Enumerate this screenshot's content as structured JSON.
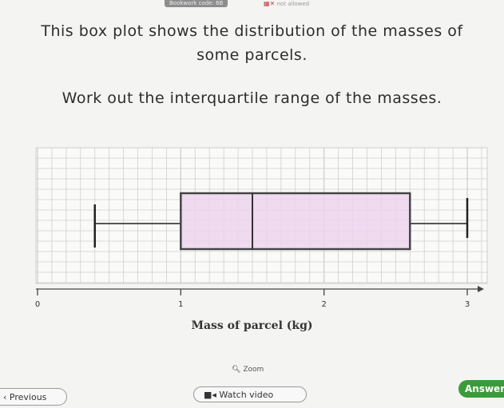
{
  "header": {
    "bookwork_code": "Bookwork code: 6B",
    "calculator_status": "not allowed",
    "calculator_icon": "calculator-crossed-icon"
  },
  "question": {
    "line1": "This box plot shows the distribution of the masses of",
    "line2": "some parcels.",
    "instruction": "Work out the interquartile range of the masses."
  },
  "chart_data": {
    "type": "boxplot",
    "xlabel": "Mass of parcel (kg)",
    "x_ticks": [
      "0",
      "1",
      "2",
      "3"
    ],
    "xlim": [
      0,
      3.3
    ],
    "grid": true,
    "box": {
      "min": 0.4,
      "q1": 1.0,
      "median": 1.5,
      "q3": 2.6,
      "max": 3.0
    },
    "colors": {
      "box_fill": "#ecd3ee",
      "box_stroke": "#444444",
      "grid": "#cfcfcf"
    }
  },
  "tools": {
    "zoom_label": "Zoom",
    "zoom_icon": "magnifier-icon"
  },
  "footer": {
    "previous_label": "Previous",
    "watch_video_label": "Watch video",
    "video_icon": "video-camera-icon",
    "answer_label": "Answer"
  }
}
